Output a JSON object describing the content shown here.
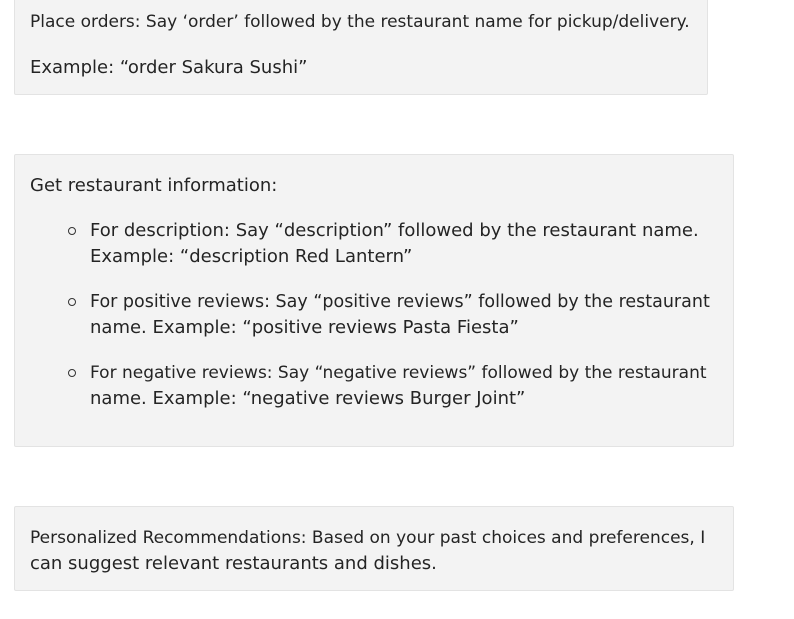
{
  "orders": {
    "line": "Place orders: Say ‘order’ followed by the restaurant name for pickup/delivery.",
    "example": "Example: “order Sakura Sushi”"
  },
  "info": {
    "heading": "Get restaurant information:",
    "items": [
      {
        "line1": "For description: Say “description” followed by the restaurant name.",
        "line2": "Example: “description Red Lantern”"
      },
      {
        "line1": "For positive reviews: Say “positive reviews” followed by the restaurant",
        "line2": "name. Example: “positive reviews Pasta Fiesta”"
      },
      {
        "line1": "For negative reviews: Say “negative reviews” followed by the restaurant",
        "line2": "name. Example: “negative reviews Burger Joint”"
      }
    ]
  },
  "recommendations": {
    "line1": "Personalized Recommendations: Based on your past choices and preferences, I",
    "line2": "can suggest relevant restaurants and dishes."
  }
}
